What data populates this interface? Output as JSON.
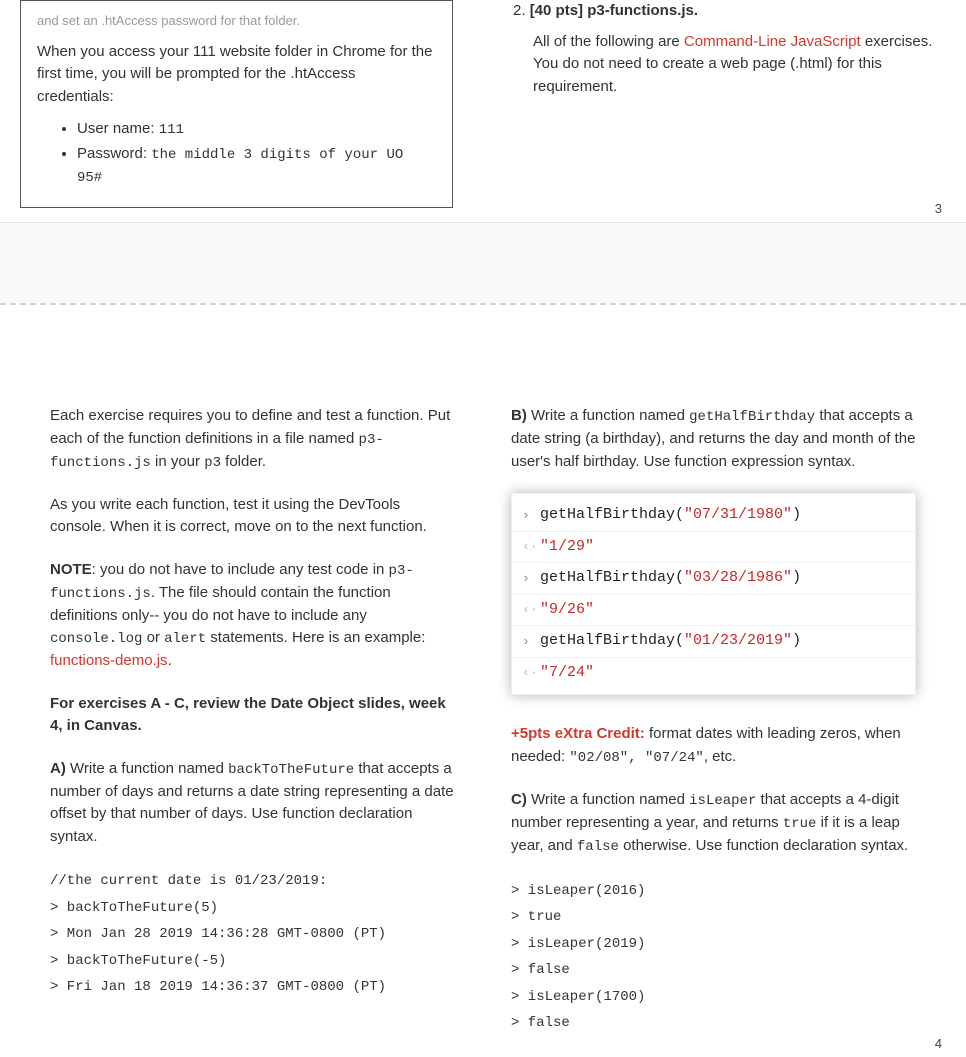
{
  "upper": {
    "box": {
      "cutoff": "and set an .htAccess password for that folder.",
      "intro": "When you access your 111 website folder in Chrome for the first time, you will be prompted for the .htAccess credentials:",
      "user_label": "User name:",
      "user_val": "111",
      "pass_label": "Password:",
      "pass_val": "the middle 3 digits of your UO 95#"
    },
    "right": {
      "num": "2.",
      "pts": "[40 pts] p3-functions.js",
      "p1a": "All of the following are ",
      "p1_link": "Command-Line JavaScript",
      "p1b": " exercises. You do not need to create a web page (.html) for this requirement."
    },
    "page_num": "3"
  },
  "lower": {
    "left": {
      "p1a": "Each exercise requires you to define and test a function. Put each of the function definitions in a file named ",
      "p1_code1": "p3-functions.js",
      "p1b": " in your ",
      "p1_code2": "p3",
      "p1c": " folder.",
      "p2": "As you write each function, test it using the DevTools console. When it is correct, move on to the next function.",
      "p3_label": "NOTE",
      "p3a": ": you do not have to include any test code in ",
      "p3_code1": "p3-functions.js",
      "p3b": ". The file should contain the function definitions only-- you do not have to include any ",
      "p3_code2": "console.log",
      "p3c": " or ",
      "p3_code3": "alert",
      "p3d": " statements. Here is an example: ",
      "p3_link": "functions-demo.js",
      "p3e": ".",
      "p4": "For exercises A - C, review the Date Object slides, week 4, in Canvas.",
      "A_label": "A)",
      "A_a": " Write a function named ",
      "A_fn": "backToTheFuture",
      "A_b": " that accepts a number of days and returns a date string representing a date offset by that number of days. Use function declaration syntax.",
      "A_code": "//the current date is 01/23/2019:\n> backToTheFuture(5)\n> Mon Jan 28 2019 14:36:28 GMT-0800 (PT)\n> backToTheFuture(-5)\n> Fri Jan 18 2019 14:36:37 GMT-0800 (PT)"
    },
    "right": {
      "B_label": "B)",
      "B_a": " Write a function named ",
      "B_fn": "getHalfBirthday",
      "B_b": " that accepts a date string (a birthday), and returns the day and month of the user's half birthday. Use function expression syntax.",
      "console": [
        {
          "dir": "in",
          "fn": "getHalfBirthday(",
          "arg": "\"07/31/1980\"",
          "close": ")"
        },
        {
          "dir": "out",
          "val": "\"1/29\""
        },
        {
          "dir": "in",
          "fn": "getHalfBirthday(",
          "arg": "\"03/28/1986\"",
          "close": ")"
        },
        {
          "dir": "out",
          "val": "\"9/26\""
        },
        {
          "dir": "in",
          "fn": "getHalfBirthday(",
          "arg": "\"01/23/2019\"",
          "close": ")"
        },
        {
          "dir": "out",
          "val": "\"7/24\""
        }
      ],
      "xc_label": "+5pts eXtra Credit:",
      "xc_a": " format dates with leading zeros, when needed: ",
      "xc_code": "\"02/08\", \"07/24\"",
      "xc_b": ", etc.",
      "C_label": "C)",
      "C_a": " Write a function named ",
      "C_fn": "isLeaper",
      "C_b": " that accepts a 4-digit number representing a year, and returns ",
      "C_true": "true",
      "C_c": " if it is a leap year, and ",
      "C_false": "false",
      "C_d": " otherwise. Use function declaration syntax.",
      "C_code": "> isLeaper(2016)\n> true\n> isLeaper(2019)\n> false\n> isLeaper(1700)\n> false"
    },
    "page_num": "4"
  }
}
